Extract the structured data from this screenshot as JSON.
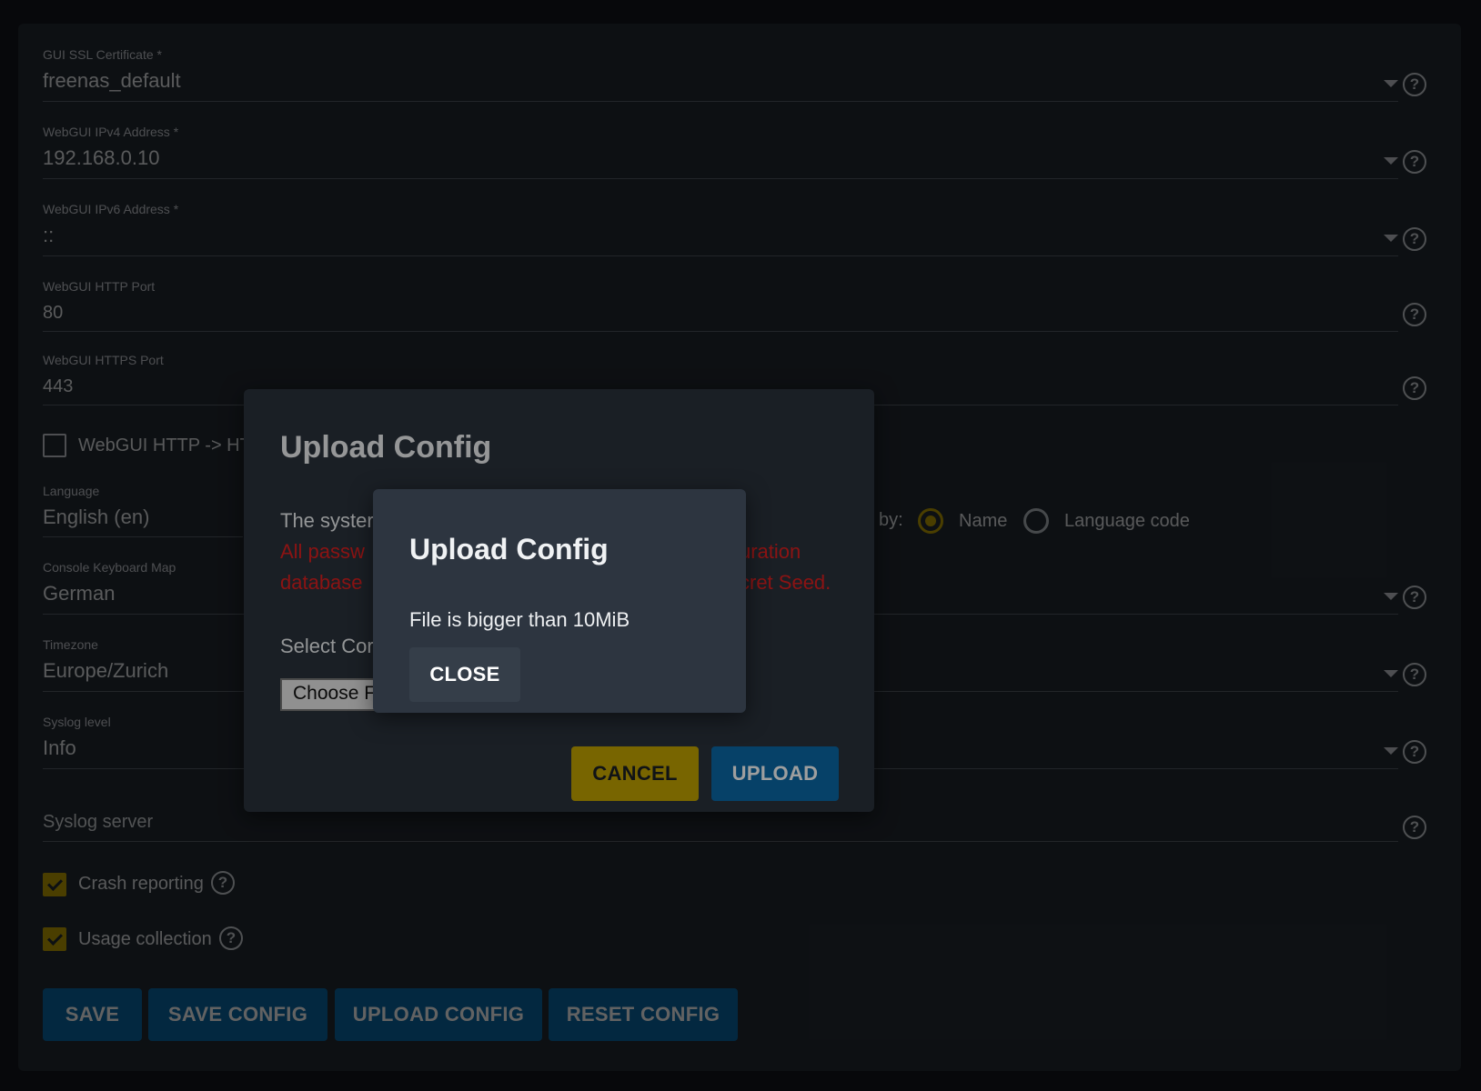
{
  "form": {
    "gui_ssl": {
      "label": "GUI SSL Certificate *",
      "value": "freenas_default"
    },
    "ipv4": {
      "label": "WebGUI IPv4 Address *",
      "value": "192.168.0.10"
    },
    "ipv6": {
      "label": "WebGUI IPv6 Address *",
      "value": "::"
    },
    "http_port": {
      "label": "WebGUI HTTP Port",
      "value": "80"
    },
    "https_port": {
      "label": "WebGUI HTTPS Port",
      "value": "443"
    },
    "redirect_label": "WebGUI HTTP -> HT",
    "language": {
      "label": "Language",
      "value": "English (en)"
    },
    "sort_label": "by:",
    "sort_options": [
      "Name",
      "Language code"
    ],
    "keyboard": {
      "label": "Console Keyboard Map",
      "value": "German"
    },
    "timezone": {
      "label": "Timezone",
      "value": "Europe/Zurich"
    },
    "syslog_level": {
      "label": "Syslog level",
      "value": "Info"
    },
    "syslog_server": {
      "placeholder": "Syslog server"
    },
    "crash_reporting": {
      "label": "Crash reporting",
      "checked": true
    },
    "usage_collection": {
      "label": "Usage collection",
      "checked": true
    },
    "buttons": {
      "save": "SAVE",
      "save_config": "SAVE CONFIG",
      "upload_config": "UPLOAD CONFIG",
      "reset_config": "RESET CONFIG"
    }
  },
  "upload_dialog": {
    "title": "Upload Config",
    "text_start": "The syster",
    "warn_line1_start": "All passw",
    "warn_line1_end": "uration",
    "warn_line2_start": "database",
    "warn_line2_end": "cret Seed.",
    "select_label": "Select Cor",
    "choose_file": "Choose F",
    "cancel": "CANCEL",
    "upload": "UPLOAD"
  },
  "error_dialog": {
    "title": "Upload Config",
    "message": "File is bigger than 10MiB",
    "close": "CLOSE"
  },
  "colors": {
    "accent_yellow": "#c2a400",
    "primary_blue": "#0b6aa9",
    "warning_red": "#e02020"
  },
  "icons": {
    "help": "question-circle-icon",
    "dropdown": "caret-down-icon",
    "check": "checkmark-icon"
  }
}
